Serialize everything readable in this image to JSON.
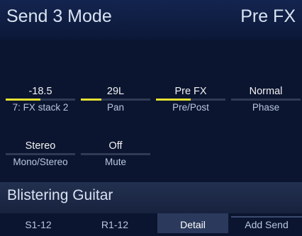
{
  "header": {
    "title": "Send 3 Mode",
    "mode_value": "Pre FX"
  },
  "params": [
    {
      "value": "-18.5",
      "label": "7: FX stack 2",
      "level": 0.5
    },
    {
      "value": "29L",
      "label": "Pan",
      "level": 0.3
    },
    {
      "value": "Pre FX",
      "label": "Pre/Post",
      "level": 0.5
    },
    {
      "value": "Normal",
      "label": "Phase",
      "level": 0
    },
    {
      "value": "Stereo",
      "label": "Mono/Stereo",
      "level": 0
    },
    {
      "value": "Off",
      "label": "Mute",
      "level": 0
    }
  ],
  "channel": {
    "name": "Blistering Guitar"
  },
  "softkeys": [
    {
      "label": "S1-12",
      "active": false
    },
    {
      "label": "R1-12",
      "active": false
    },
    {
      "label": "Detail",
      "active": true
    },
    {
      "label": "Add Send",
      "active": false
    }
  ],
  "colors": {
    "background": "#0b1530",
    "level_fill": "#e6e033",
    "label_text": "#b9c6de"
  }
}
